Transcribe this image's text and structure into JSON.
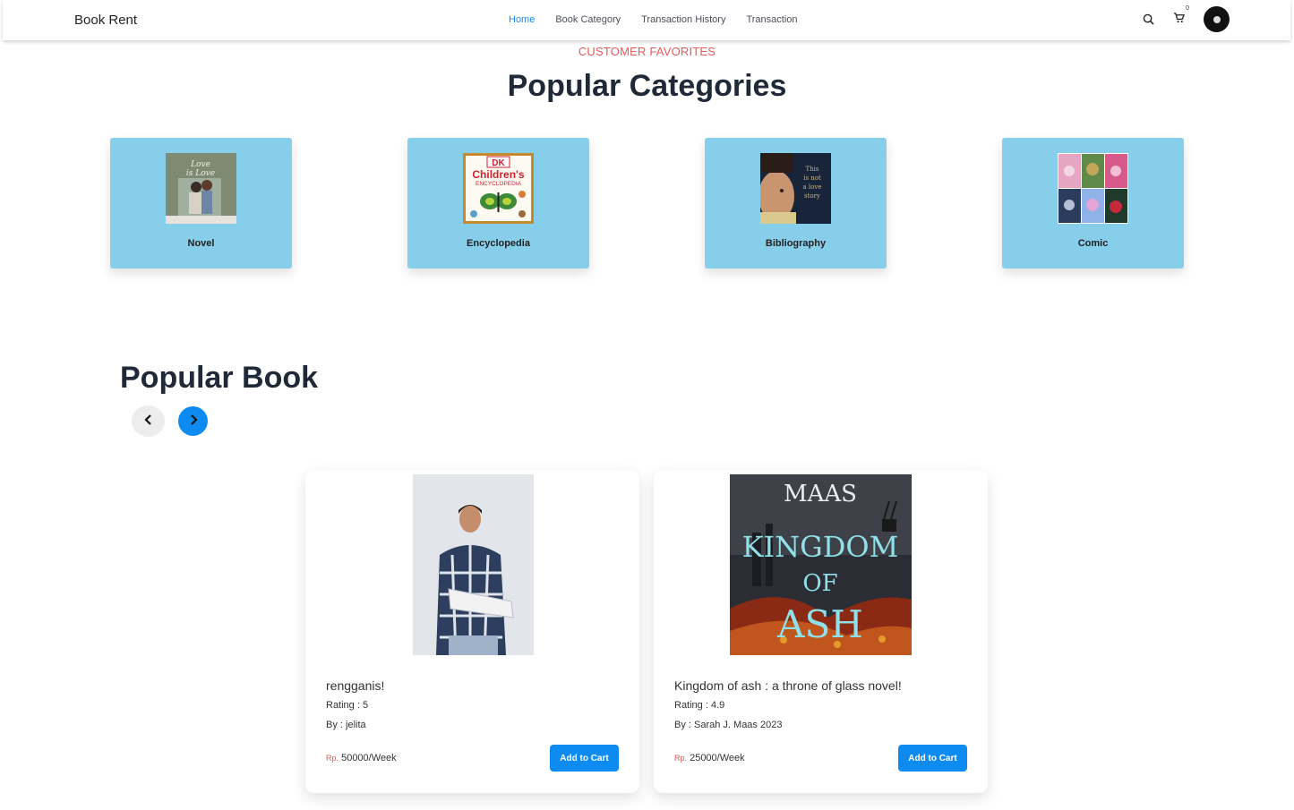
{
  "nav": {
    "brand": "Book Rent",
    "links": [
      "Home",
      "Book Category",
      "Transaction History",
      "Transaction"
    ],
    "active": "Home",
    "cart_count": "0",
    "icons": [
      "search-icon",
      "cart-icon",
      "avatar"
    ]
  },
  "categories_section": {
    "eyebrow": "CUSTOMER FAVORITES",
    "title": "Popular Categories",
    "items": [
      {
        "label": "Novel"
      },
      {
        "label": "Encyclopedia"
      },
      {
        "label": "Bibliography"
      },
      {
        "label": "Comic"
      }
    ]
  },
  "books_section": {
    "title": "Popular Book",
    "books": [
      {
        "name": "rengganis!",
        "rating": "Rating : 5",
        "by": "By : jelita",
        "currency": "Rp.",
        "price": "50000/Week",
        "button": "Add to Cart"
      },
      {
        "name": "Kingdom of ash : a throne of glass novel!",
        "rating": "Rating : 4.9",
        "by": "By : Sarah J. Maas 2023",
        "currency": "Rp.",
        "price": "25000/Week",
        "button": "Add to Cart"
      }
    ]
  },
  "cover_text": {
    "novel": "Love is Love",
    "encyclopedia_brand": "DK",
    "encyclopedia_title": "Children's",
    "encyclopedia_sub": "ENCYCLOPEDIA",
    "biblio": "This is not a love story",
    "kingdom_author": "MAAS",
    "kingdom_title1": "KINGDOM",
    "kingdom_title2": "OF",
    "kingdom_title3": "ASH"
  },
  "colors": {
    "accent": "#0d8bf0",
    "category_card": "#87ceeb",
    "eyebrow": "#e55a5a",
    "nav_active": "#1e88e5"
  }
}
